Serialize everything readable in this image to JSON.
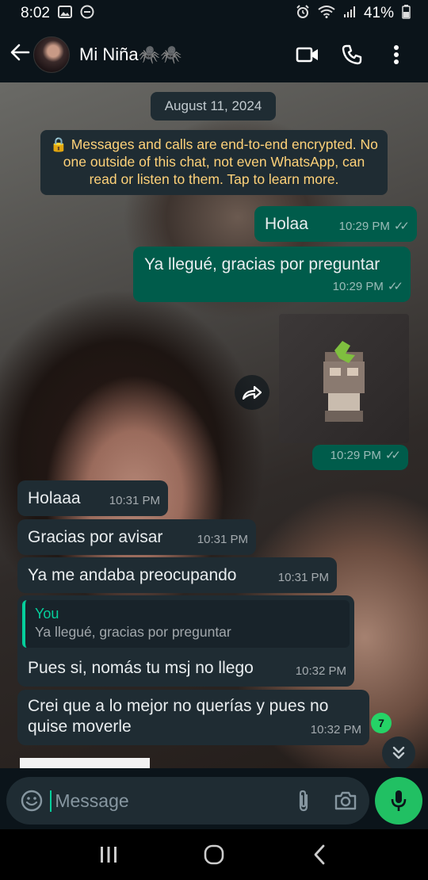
{
  "status_bar": {
    "time": "8:02",
    "battery": "41%"
  },
  "header": {
    "contact_name": "Mi Niña🕷️🕷️",
    "icons": [
      "back-arrow-icon",
      "video-call-icon",
      "phone-icon",
      "more-vert-icon"
    ]
  },
  "chat": {
    "date_chip": "August 11, 2024",
    "encryption_notice": "🔒 Messages and calls are end-to-end encrypted. No one outside of this chat, not even WhatsApp, can read or listen to them. Tap to learn more.",
    "messages": [
      {
        "direction": "out",
        "text": "Holaa",
        "time": "10:29 PM"
      },
      {
        "direction": "out",
        "text": "Ya llegué, gracias por preguntar",
        "time": "10:29 PM"
      },
      {
        "direction": "out",
        "type": "sticker",
        "time": "10:29 PM"
      },
      {
        "direction": "in",
        "text": "Holaaa",
        "time": "10:31 PM"
      },
      {
        "direction": "in",
        "text": "Gracias por avisar",
        "time": "10:31 PM"
      },
      {
        "direction": "in",
        "text": "Ya me andaba preocupando",
        "time": "10:31 PM"
      },
      {
        "direction": "in",
        "quote_author": "You",
        "quote_text": "Ya llegué, gracias por preguntar",
        "text": "Pues si, nomás tu msj no llego",
        "time": "10:32 PM"
      },
      {
        "direction": "in",
        "text": "Crei que a lo mejor no querías y pues no quise moverle",
        "time": "10:32 PM"
      }
    ],
    "unread_badge": "7"
  },
  "input": {
    "placeholder": "Message"
  },
  "colors": {
    "outgoing_bubble": "#005c4b",
    "incoming_bubble": "#1f2c33",
    "accent_green": "#21c063",
    "encryption_text": "#ffd279"
  }
}
